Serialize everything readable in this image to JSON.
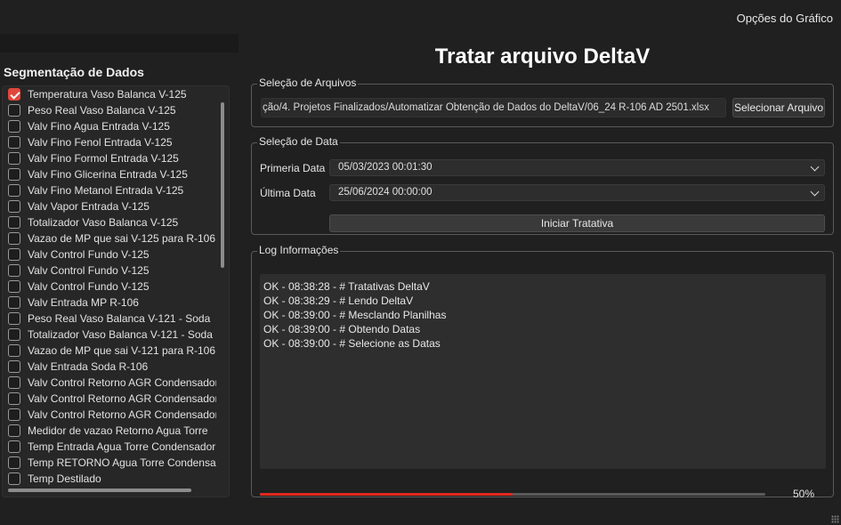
{
  "menu": {
    "chart_options": "Opções do Gráfico"
  },
  "segmentation": {
    "title": "Segmentação de Dados",
    "items": [
      {
        "label": "Temperatura Vaso Balanca V-125",
        "checked": true
      },
      {
        "label": "Peso Real Vaso Balanca V-125",
        "checked": false
      },
      {
        "label": "Valv Fino Agua Entrada V-125",
        "checked": false
      },
      {
        "label": "Valv Fino Fenol Entrada V-125",
        "checked": false
      },
      {
        "label": "Valv Fino Formol Entrada V-125",
        "checked": false
      },
      {
        "label": "Valv Fino Glicerina Entrada V-125",
        "checked": false
      },
      {
        "label": "Valv Fino Metanol Entrada V-125",
        "checked": false
      },
      {
        "label": "Valv Vapor Entrada V-125",
        "checked": false
      },
      {
        "label": "Totalizador Vaso Balanca V-125",
        "checked": false
      },
      {
        "label": "Vazao de MP que sai V-125 para R-106",
        "checked": false
      },
      {
        "label": "Valv Control Fundo V-125",
        "checked": false
      },
      {
        "label": "Valv Control Fundo V-125",
        "checked": false
      },
      {
        "label": "Valv Control Fundo V-125",
        "checked": false
      },
      {
        "label": "Valv Entrada MP R-106",
        "checked": false
      },
      {
        "label": "Peso Real Vaso Balanca V-121 - Soda",
        "checked": false
      },
      {
        "label": "Totalizador Vaso Balanca V-121 - Soda",
        "checked": false
      },
      {
        "label": "Vazao de MP que sai V-121 para R-106",
        "checked": false
      },
      {
        "label": "Valv Entrada Soda R-106",
        "checked": false
      },
      {
        "label": "Valv Control Retorno AGR Condensador",
        "checked": false
      },
      {
        "label": "Valv Control Retorno AGR Condensador",
        "checked": false
      },
      {
        "label": "Valv Control Retorno AGR Condensador",
        "checked": false
      },
      {
        "label": "Medidor de vazao Retorno Agua Torre",
        "checked": false
      },
      {
        "label": "Temp Entrada Agua Torre Condensador",
        "checked": false
      },
      {
        "label": "Temp RETORNO Agua Torre Condensador",
        "checked": false
      },
      {
        "label": "Temp Destilado",
        "checked": false
      }
    ]
  },
  "main": {
    "title": "Tratar arquivo DeltaV",
    "files": {
      "legend": "Seleção de Arquivos",
      "path": "ção/4. Projetos Finalizados/Automatizar Obtenção de Dados do DeltaV/06_24 R-106 AD 2501.xlsx",
      "select_button": "Selecionar Arquivo"
    },
    "dates": {
      "legend": "Seleção de Data",
      "first_label": "Primeria Data",
      "first_value": "05/03/2023 00:01:30",
      "last_label": "Última Data",
      "last_value": "25/06/2024 00:00:00",
      "start_button": "Iniciar Tratativa"
    },
    "log": {
      "legend": "Log Informações",
      "lines": [
        "OK - 08:38:28 - # Tratativas DeltaV",
        "OK - 08:38:29 - # Lendo DeltaV",
        "OK - 08:39:00 - # Mesclando Planilhas",
        "OK - 08:39:00 - # Obtendo Datas",
        "OK - 08:39:00 - # Selecione as Datas"
      ],
      "progress": 0.5,
      "progress_text": "50%"
    }
  },
  "colors": {
    "accent": "#e0291f",
    "background": "#202020"
  }
}
